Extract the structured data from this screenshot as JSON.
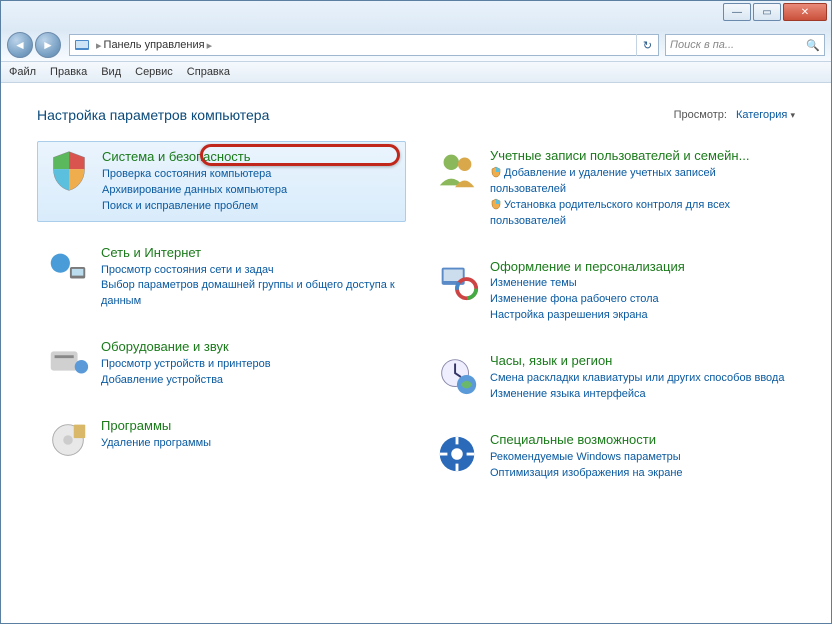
{
  "window": {
    "min": "—",
    "max": "▭",
    "close": "✕"
  },
  "nav": {
    "back": "◄",
    "fwd": "►"
  },
  "address": {
    "title": "Панель управления",
    "sep": "▸",
    "refresh": "↻"
  },
  "search": {
    "placeholder": "Поиск в па...",
    "icon": "🔍"
  },
  "menu": [
    "Файл",
    "Правка",
    "Вид",
    "Сервис",
    "Справка"
  ],
  "header": "Настройка параметров компьютера",
  "view": {
    "label": "Просмотр:",
    "value": "Категория",
    "chev": "▾"
  },
  "left": [
    {
      "title": "Система и безопасность",
      "hl": true,
      "links": [
        "Проверка состояния компьютера",
        "Архивирование данных компьютера",
        "Поиск и исправление проблем"
      ]
    },
    {
      "title": "Сеть и Интернет",
      "links": [
        "Просмотр состояния сети и задач",
        "Выбор параметров домашней группы и общего доступа к данным"
      ]
    },
    {
      "title": "Оборудование и звук",
      "links": [
        "Просмотр устройств и принтеров",
        "Добавление устройства"
      ]
    },
    {
      "title": "Программы",
      "links": [
        "Удаление программы"
      ]
    }
  ],
  "right": [
    {
      "title": "Учетные записи пользователей и семейн...",
      "links": [
        {
          "t": "Добавление и удаление учетных записей пользователей",
          "s": true
        },
        {
          "t": "Установка родительского контроля для всех пользователей",
          "s": true
        }
      ]
    },
    {
      "title": "Оформление и персонализация",
      "links": [
        {
          "t": "Изменение темы"
        },
        {
          "t": "Изменение фона рабочего стола"
        },
        {
          "t": "Настройка разрешения экрана"
        }
      ]
    },
    {
      "title": "Часы, язык и регион",
      "links": [
        {
          "t": "Смена раскладки клавиатуры или других способов ввода"
        },
        {
          "t": "Изменение языка интерфейса"
        }
      ]
    },
    {
      "title": "Специальные возможности",
      "links": [
        {
          "t": "Рекомендуемые Windows параметры"
        },
        {
          "t": "Оптимизация изображения на экране"
        }
      ]
    }
  ]
}
